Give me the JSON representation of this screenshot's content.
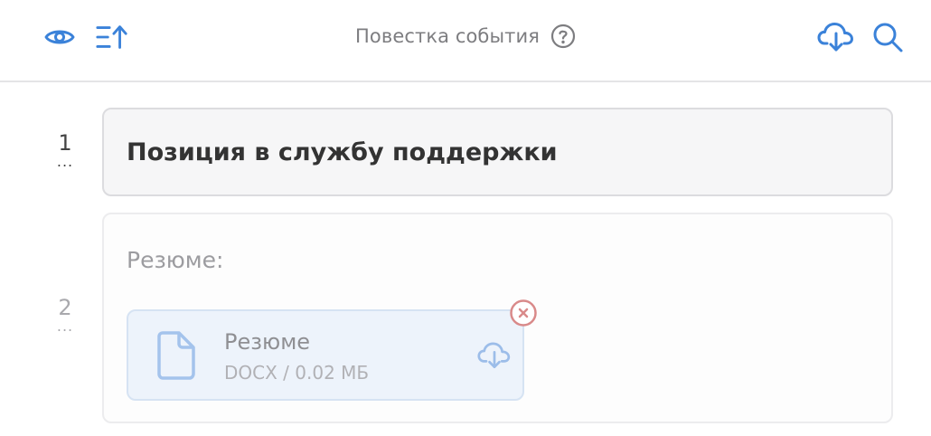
{
  "header": {
    "title": "Повестка события",
    "icons": [
      "eye-icon",
      "sort-ascending-icon",
      "help-circle-icon",
      "cloud-download-icon",
      "search-icon"
    ]
  },
  "colors": {
    "accent": "#3b82d9",
    "remove": "#d98a8a"
  },
  "agenda": {
    "items": [
      {
        "number": "1",
        "dots": "...",
        "title": "Позиция в службу поддержки"
      },
      {
        "number": "2",
        "dots": "...",
        "label": "Резюме:",
        "file": {
          "name": "Резюме",
          "meta": "DOCX / 0.02 МБ"
        }
      }
    ]
  }
}
